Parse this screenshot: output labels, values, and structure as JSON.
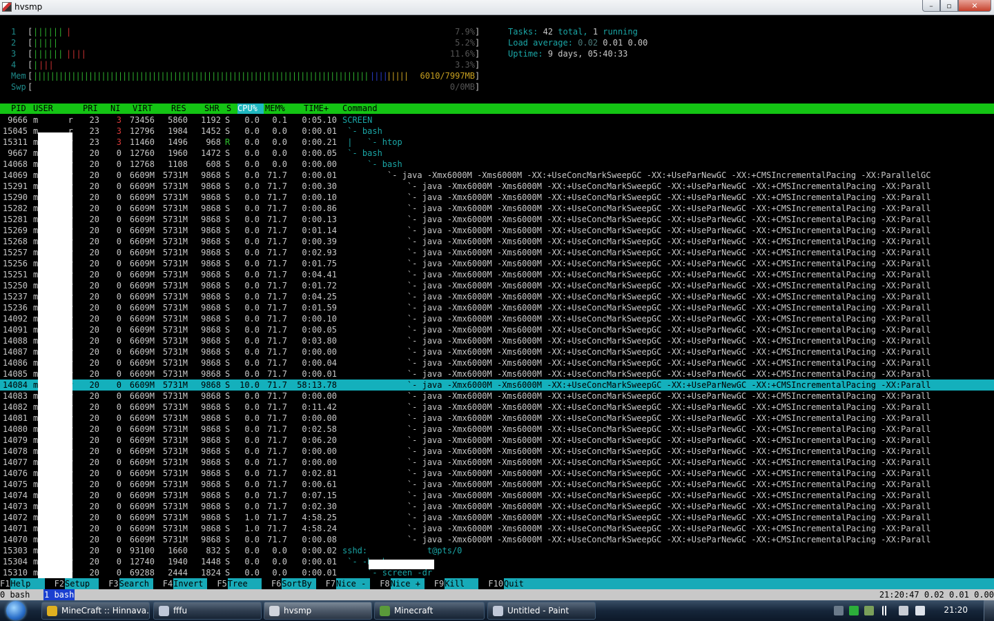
{
  "window": {
    "title": "hvsmp",
    "controls": {
      "minimize": "–",
      "maximize": "▫",
      "close": "✕"
    }
  },
  "meters": {
    "cpus": [
      {
        "label": "1",
        "bar": "||||||",
        "bar_hi": "|",
        "value": "7.9%"
      },
      {
        "label": "2",
        "bar": "|||||",
        "bar_hi": "",
        "value": "5.2%"
      },
      {
        "label": "3",
        "bar": "||||||",
        "bar_hi": "||||",
        "value": "11.6%"
      },
      {
        "label": "4",
        "bar": "|",
        "bar_hi": "|||",
        "value": "3.3%"
      }
    ],
    "mem": {
      "label": "Mem",
      "bar": "||||||||||||||||||||||||||||||||||||||||||||||||||||||||||||||||||||||||||||||||",
      "bar_blue": "||||",
      "bar_tail": "|||||",
      "value": "6010/7997MB"
    },
    "swp": {
      "label": "Swp",
      "value": "0/0MB"
    }
  },
  "info": {
    "tasks": {
      "label": "Tasks: ",
      "total": "42",
      "total_word": " total, ",
      "running": "1",
      "running_word": " running"
    },
    "load": {
      "label": "Load average: ",
      "l1": "0.02",
      "l5": "0.01",
      "l15": "0.00"
    },
    "uptime": {
      "label": "Uptime: ",
      "value": "9 days, 05:40:33"
    }
  },
  "columns": {
    "pid": "PID",
    "user": "USER",
    "pri": "PRI",
    "ni": "NI",
    "virt": "VIRT",
    "res": "RES",
    "shr": "SHR",
    "s": "S",
    "cpu": "CPU%",
    "mem": "MEM%",
    "time": "TIME+",
    "command": "Command"
  },
  "processes": [
    {
      "pid": "9666",
      "user": "m      r",
      "pri": "23",
      "ni": "3",
      "virt": "73456",
      "res": "5860",
      "shr": "1192",
      "s": "S",
      "cpu": "0.0",
      "mem": "0.1",
      "time": "0:05.10",
      "cmd": "SCREEN"
    },
    {
      "pid": "15045",
      "user": "m      r",
      "pri": "23",
      "ni": "3",
      "virt": "12796",
      "res": "1984",
      "shr": "1452",
      "s": "S",
      "cpu": "0.0",
      "mem": "0.0",
      "time": "0:00.01",
      "cmd": " `- bash"
    },
    {
      "pid": "15311",
      "user": "m      r",
      "pri": "23",
      "ni": "3",
      "virt": "11460",
      "res": "1496",
      "shr": "968",
      "s": "R",
      "cpu": "0.0",
      "mem": "0.0",
      "time": "0:00.21",
      "cmd": " |   `- htop"
    },
    {
      "pid": "9667",
      "user": "m      r",
      "pri": "20",
      "ni": "0",
      "virt": "12760",
      "res": "1960",
      "shr": "1472",
      "s": "S",
      "cpu": "0.0",
      "mem": "0.0",
      "time": "0:00.05",
      "cmd": " `- bash"
    },
    {
      "pid": "14068",
      "user": "m      r",
      "pri": "20",
      "ni": "0",
      "virt": "12768",
      "res": "1108",
      "shr": "608",
      "s": "S",
      "cpu": "0.0",
      "mem": "0.0",
      "time": "0:00.00",
      "cmd": "     `- bash"
    },
    {
      "pid": "14069",
      "user": "m      r",
      "pri": "20",
      "ni": "0",
      "virt": "6609M",
      "res": "5731M",
      "shr": "9868",
      "s": "S",
      "cpu": "0.0",
      "mem": "71.7",
      "time": "0:00.01",
      "cmd": "         `- java -Xmx6000M -Xms6000M -XX:+UseConcMarkSweepGC -XX:+UseParNewGC -XX:+CMSIncrementalPacing -XX:ParallelGC"
    },
    {
      "pid": "15291",
      "user": "m      r",
      "pri": "20",
      "ni": "0",
      "virt": "6609M",
      "res": "5731M",
      "shr": "9868",
      "s": "S",
      "cpu": "0.0",
      "mem": "71.7",
      "time": "0:00.30",
      "cmd": "             `- java -Xmx6000M -Xms6000M -XX:+UseConcMarkSweepGC -XX:+UseParNewGC -XX:+CMSIncrementalPacing -XX:Parall"
    },
    {
      "pid": "15290",
      "user": "m      r",
      "pri": "20",
      "ni": "0",
      "virt": "6609M",
      "res": "5731M",
      "shr": "9868",
      "s": "S",
      "cpu": "0.0",
      "mem": "71.7",
      "time": "0:00.10",
      "cmd": "             `- java -Xmx6000M -Xms6000M -XX:+UseConcMarkSweepGC -XX:+UseParNewGC -XX:+CMSIncrementalPacing -XX:Parall"
    },
    {
      "pid": "15282",
      "user": "m      r",
      "pri": "20",
      "ni": "0",
      "virt": "6609M",
      "res": "5731M",
      "shr": "9868",
      "s": "S",
      "cpu": "0.0",
      "mem": "71.7",
      "time": "0:00.86",
      "cmd": "             `- java -Xmx6000M -Xms6000M -XX:+UseConcMarkSweepGC -XX:+UseParNewGC -XX:+CMSIncrementalPacing -XX:Parall"
    },
    {
      "pid": "15281",
      "user": "m      r",
      "pri": "20",
      "ni": "0",
      "virt": "6609M",
      "res": "5731M",
      "shr": "9868",
      "s": "S",
      "cpu": "0.0",
      "mem": "71.7",
      "time": "0:00.13",
      "cmd": "             `- java -Xmx6000M -Xms6000M -XX:+UseConcMarkSweepGC -XX:+UseParNewGC -XX:+CMSIncrementalPacing -XX:Parall"
    },
    {
      "pid": "15269",
      "user": "m      r",
      "pri": "20",
      "ni": "0",
      "virt": "6609M",
      "res": "5731M",
      "shr": "9868",
      "s": "S",
      "cpu": "0.0",
      "mem": "71.7",
      "time": "0:01.14",
      "cmd": "             `- java -Xmx6000M -Xms6000M -XX:+UseConcMarkSweepGC -XX:+UseParNewGC -XX:+CMSIncrementalPacing -XX:Parall"
    },
    {
      "pid": "15268",
      "user": "m      r",
      "pri": "20",
      "ni": "0",
      "virt": "6609M",
      "res": "5731M",
      "shr": "9868",
      "s": "S",
      "cpu": "0.0",
      "mem": "71.7",
      "time": "0:00.39",
      "cmd": "             `- java -Xmx6000M -Xms6000M -XX:+UseConcMarkSweepGC -XX:+UseParNewGC -XX:+CMSIncrementalPacing -XX:Parall"
    },
    {
      "pid": "15257",
      "user": "m      r",
      "pri": "20",
      "ni": "0",
      "virt": "6609M",
      "res": "5731M",
      "shr": "9868",
      "s": "S",
      "cpu": "0.0",
      "mem": "71.7",
      "time": "0:02.93",
      "cmd": "             `- java -Xmx6000M -Xms6000M -XX:+UseConcMarkSweepGC -XX:+UseParNewGC -XX:+CMSIncrementalPacing -XX:Parall"
    },
    {
      "pid": "15256",
      "user": "m      r",
      "pri": "20",
      "ni": "0",
      "virt": "6609M",
      "res": "5731M",
      "shr": "9868",
      "s": "S",
      "cpu": "0.0",
      "mem": "71.7",
      "time": "0:01.75",
      "cmd": "             `- java -Xmx6000M -Xms6000M -XX:+UseConcMarkSweepGC -XX:+UseParNewGC -XX:+CMSIncrementalPacing -XX:Parall"
    },
    {
      "pid": "15251",
      "user": "m      r",
      "pri": "20",
      "ni": "0",
      "virt": "6609M",
      "res": "5731M",
      "shr": "9868",
      "s": "S",
      "cpu": "0.0",
      "mem": "71.7",
      "time": "0:04.41",
      "cmd": "             `- java -Xmx6000M -Xms6000M -XX:+UseConcMarkSweepGC -XX:+UseParNewGC -XX:+CMSIncrementalPacing -XX:Parall"
    },
    {
      "pid": "15250",
      "user": "m      r",
      "pri": "20",
      "ni": "0",
      "virt": "6609M",
      "res": "5731M",
      "shr": "9868",
      "s": "S",
      "cpu": "0.0",
      "mem": "71.7",
      "time": "0:01.72",
      "cmd": "             `- java -Xmx6000M -Xms6000M -XX:+UseConcMarkSweepGC -XX:+UseParNewGC -XX:+CMSIncrementalPacing -XX:Parall"
    },
    {
      "pid": "15237",
      "user": "m      r",
      "pri": "20",
      "ni": "0",
      "virt": "6609M",
      "res": "5731M",
      "shr": "9868",
      "s": "S",
      "cpu": "0.0",
      "mem": "71.7",
      "time": "0:04.25",
      "cmd": "             `- java -Xmx6000M -Xms6000M -XX:+UseConcMarkSweepGC -XX:+UseParNewGC -XX:+CMSIncrementalPacing -XX:Parall"
    },
    {
      "pid": "15236",
      "user": "m      r",
      "pri": "20",
      "ni": "0",
      "virt": "6609M",
      "res": "5731M",
      "shr": "9868",
      "s": "S",
      "cpu": "0.0",
      "mem": "71.7",
      "time": "0:01.59",
      "cmd": "             `- java -Xmx6000M -Xms6000M -XX:+UseConcMarkSweepGC -XX:+UseParNewGC -XX:+CMSIncrementalPacing -XX:Parall"
    },
    {
      "pid": "14092",
      "user": "m      r",
      "pri": "20",
      "ni": "0",
      "virt": "6609M",
      "res": "5731M",
      "shr": "9868",
      "s": "S",
      "cpu": "0.0",
      "mem": "71.7",
      "time": "0:00.10",
      "cmd": "             `- java -Xmx6000M -Xms6000M -XX:+UseConcMarkSweepGC -XX:+UseParNewGC -XX:+CMSIncrementalPacing -XX:Parall"
    },
    {
      "pid": "14091",
      "user": "m      r",
      "pri": "20",
      "ni": "0",
      "virt": "6609M",
      "res": "5731M",
      "shr": "9868",
      "s": "S",
      "cpu": "0.0",
      "mem": "71.7",
      "time": "0:00.05",
      "cmd": "             `- java -Xmx6000M -Xms6000M -XX:+UseConcMarkSweepGC -XX:+UseParNewGC -XX:+CMSIncrementalPacing -XX:Parall"
    },
    {
      "pid": "14088",
      "user": "m      r",
      "pri": "20",
      "ni": "0",
      "virt": "6609M",
      "res": "5731M",
      "shr": "9868",
      "s": "S",
      "cpu": "0.0",
      "mem": "71.7",
      "time": "0:03.80",
      "cmd": "             `- java -Xmx6000M -Xms6000M -XX:+UseConcMarkSweepGC -XX:+UseParNewGC -XX:+CMSIncrementalPacing -XX:Parall"
    },
    {
      "pid": "14087",
      "user": "m      r",
      "pri": "20",
      "ni": "0",
      "virt": "6609M",
      "res": "5731M",
      "shr": "9868",
      "s": "S",
      "cpu": "0.0",
      "mem": "71.7",
      "time": "0:00.00",
      "cmd": "             `- java -Xmx6000M -Xms6000M -XX:+UseConcMarkSweepGC -XX:+UseParNewGC -XX:+CMSIncrementalPacing -XX:Parall"
    },
    {
      "pid": "14086",
      "user": "m      r",
      "pri": "20",
      "ni": "0",
      "virt": "6609M",
      "res": "5731M",
      "shr": "9868",
      "s": "S",
      "cpu": "0.0",
      "mem": "71.7",
      "time": "0:00.04",
      "cmd": "             `- java -Xmx6000M -Xms6000M -XX:+UseConcMarkSweepGC -XX:+UseParNewGC -XX:+CMSIncrementalPacing -XX:Parall"
    },
    {
      "pid": "14085",
      "user": "m      r",
      "pri": "20",
      "ni": "0",
      "virt": "6609M",
      "res": "5731M",
      "shr": "9868",
      "s": "S",
      "cpu": "0.0",
      "mem": "71.7",
      "time": "0:00.01",
      "cmd": "             `- java -Xmx6000M -Xms6000M -XX:+UseConcMarkSweepGC -XX:+UseParNewGC -XX:+CMSIncrementalPacing -XX:Parall"
    },
    {
      "pid": "14084",
      "user": "m      r",
      "pri": "20",
      "ni": "0",
      "virt": "6609M",
      "res": "5731M",
      "shr": "9868",
      "s": "S",
      "cpu": "10.0",
      "mem": "71.7",
      "time": "58:13.78",
      "cmd": "             `- java -Xmx6000M -Xms6000M -XX:+UseConcMarkSweepGC -XX:+UseParNewGC -XX:+CMSIncrementalPacing -XX:Parall",
      "highlight": true
    },
    {
      "pid": "14083",
      "user": "m      r",
      "pri": "20",
      "ni": "0",
      "virt": "6609M",
      "res": "5731M",
      "shr": "9868",
      "s": "S",
      "cpu": "0.0",
      "mem": "71.7",
      "time": "0:00.00",
      "cmd": "             `- java -Xmx6000M -Xms6000M -XX:+UseConcMarkSweepGC -XX:+UseParNewGC -XX:+CMSIncrementalPacing -XX:Parall"
    },
    {
      "pid": "14082",
      "user": "m      r",
      "pri": "20",
      "ni": "0",
      "virt": "6609M",
      "res": "5731M",
      "shr": "9868",
      "s": "S",
      "cpu": "0.0",
      "mem": "71.7",
      "time": "0:11.42",
      "cmd": "             `- java -Xmx6000M -Xms6000M -XX:+UseConcMarkSweepGC -XX:+UseParNewGC -XX:+CMSIncrementalPacing -XX:Parall"
    },
    {
      "pid": "14081",
      "user": "m      r",
      "pri": "20",
      "ni": "0",
      "virt": "6609M",
      "res": "5731M",
      "shr": "9868",
      "s": "S",
      "cpu": "0.0",
      "mem": "71.7",
      "time": "0:00.00",
      "cmd": "             `- java -Xmx6000M -Xms6000M -XX:+UseConcMarkSweepGC -XX:+UseParNewGC -XX:+CMSIncrementalPacing -XX:Parall"
    },
    {
      "pid": "14080",
      "user": "m      r",
      "pri": "20",
      "ni": "0",
      "virt": "6609M",
      "res": "5731M",
      "shr": "9868",
      "s": "S",
      "cpu": "0.0",
      "mem": "71.7",
      "time": "0:02.58",
      "cmd": "             `- java -Xmx6000M -Xms6000M -XX:+UseConcMarkSweepGC -XX:+UseParNewGC -XX:+CMSIncrementalPacing -XX:Parall"
    },
    {
      "pid": "14079",
      "user": "m      r",
      "pri": "20",
      "ni": "0",
      "virt": "6609M",
      "res": "5731M",
      "shr": "9868",
      "s": "S",
      "cpu": "0.0",
      "mem": "71.7",
      "time": "0:06.20",
      "cmd": "             `- java -Xmx6000M -Xms6000M -XX:+UseConcMarkSweepGC -XX:+UseParNewGC -XX:+CMSIncrementalPacing -XX:Parall"
    },
    {
      "pid": "14078",
      "user": "m      r",
      "pri": "20",
      "ni": "0",
      "virt": "6609M",
      "res": "5731M",
      "shr": "9868",
      "s": "S",
      "cpu": "0.0",
      "mem": "71.7",
      "time": "0:00.00",
      "cmd": "             `- java -Xmx6000M -Xms6000M -XX:+UseConcMarkSweepGC -XX:+UseParNewGC -XX:+CMSIncrementalPacing -XX:Parall"
    },
    {
      "pid": "14077",
      "user": "m      r",
      "pri": "20",
      "ni": "0",
      "virt": "6609M",
      "res": "5731M",
      "shr": "9868",
      "s": "S",
      "cpu": "0.0",
      "mem": "71.7",
      "time": "0:00.00",
      "cmd": "             `- java -Xmx6000M -Xms6000M -XX:+UseConcMarkSweepGC -XX:+UseParNewGC -XX:+CMSIncrementalPacing -XX:Parall"
    },
    {
      "pid": "14076",
      "user": "m      r",
      "pri": "20",
      "ni": "0",
      "virt": "6609M",
      "res": "5731M",
      "shr": "9868",
      "s": "S",
      "cpu": "0.0",
      "mem": "71.7",
      "time": "0:02.81",
      "cmd": "             `- java -Xmx6000M -Xms6000M -XX:+UseConcMarkSweepGC -XX:+UseParNewGC -XX:+CMSIncrementalPacing -XX:Parall"
    },
    {
      "pid": "14075",
      "user": "m      r",
      "pri": "20",
      "ni": "0",
      "virt": "6609M",
      "res": "5731M",
      "shr": "9868",
      "s": "S",
      "cpu": "0.0",
      "mem": "71.7",
      "time": "0:00.61",
      "cmd": "             `- java -Xmx6000M -Xms6000M -XX:+UseConcMarkSweepGC -XX:+UseParNewGC -XX:+CMSIncrementalPacing -XX:Parall"
    },
    {
      "pid": "14074",
      "user": "m      r",
      "pri": "20",
      "ni": "0",
      "virt": "6609M",
      "res": "5731M",
      "shr": "9868",
      "s": "S",
      "cpu": "0.0",
      "mem": "71.7",
      "time": "0:07.15",
      "cmd": "             `- java -Xmx6000M -Xms6000M -XX:+UseConcMarkSweepGC -XX:+UseParNewGC -XX:+CMSIncrementalPacing -XX:Parall"
    },
    {
      "pid": "14073",
      "user": "m      r",
      "pri": "20",
      "ni": "0",
      "virt": "6609M",
      "res": "5731M",
      "shr": "9868",
      "s": "S",
      "cpu": "0.0",
      "mem": "71.7",
      "time": "0:02.30",
      "cmd": "             `- java -Xmx6000M -Xms6000M -XX:+UseConcMarkSweepGC -XX:+UseParNewGC -XX:+CMSIncrementalPacing -XX:Parall"
    },
    {
      "pid": "14072",
      "user": "m      r",
      "pri": "20",
      "ni": "0",
      "virt": "6609M",
      "res": "5731M",
      "shr": "9868",
      "s": "S",
      "cpu": "1.0",
      "mem": "71.7",
      "time": "4:58.25",
      "cmd": "             `- java -Xmx6000M -Xms6000M -XX:+UseConcMarkSweepGC -XX:+UseParNewGC -XX:+CMSIncrementalPacing -XX:Parall"
    },
    {
      "pid": "14071",
      "user": "m      r",
      "pri": "20",
      "ni": "0",
      "virt": "6609M",
      "res": "5731M",
      "shr": "9868",
      "s": "S",
      "cpu": "1.0",
      "mem": "71.7",
      "time": "4:58.24",
      "cmd": "             `- java -Xmx6000M -Xms6000M -XX:+UseConcMarkSweepGC -XX:+UseParNewGC -XX:+CMSIncrementalPacing -XX:Parall"
    },
    {
      "pid": "14070",
      "user": "m      r",
      "pri": "20",
      "ni": "0",
      "virt": "6609M",
      "res": "5731M",
      "shr": "9868",
      "s": "S",
      "cpu": "0.0",
      "mem": "71.7",
      "time": "0:00.08",
      "cmd": "             `- java -Xmx6000M -Xms6000M -XX:+UseConcMarkSweepGC -XX:+UseParNewGC -XX:+CMSIncrementalPacing -XX:Parall"
    },
    {
      "pid": "15303",
      "user": "m      r",
      "pri": "20",
      "ni": "0",
      "virt": "93100",
      "res": "1660",
      "shr": "832",
      "s": "S",
      "cpu": "0.0",
      "mem": "0.0",
      "time": "0:00.02",
      "cmd": "sshd:            t@pts/0"
    },
    {
      "pid": "15304",
      "user": "m      r",
      "pri": "20",
      "ni": "0",
      "virt": "12740",
      "res": "1940",
      "shr": "1448",
      "s": "S",
      "cpu": "0.0",
      "mem": "0.0",
      "time": "0:00.01",
      "cmd": " `- -bash"
    },
    {
      "pid": "15310",
      "user": "m      r",
      "pri": "20",
      "ni": "0",
      "virt": "69288",
      "res": "2444",
      "shr": "1824",
      "s": "S",
      "cpu": "0.0",
      "mem": "0.0",
      "time": "0:00.01",
      "cmd": "     `- screen -dr"
    }
  ],
  "fkeys": [
    {
      "key": "F1",
      "label": "Help  "
    },
    {
      "key": "F2",
      "label": "Setup "
    },
    {
      "key": "F3",
      "label": "Search"
    },
    {
      "key": "F4",
      "label": "Invert"
    },
    {
      "key": "F5",
      "label": "Tree  "
    },
    {
      "key": "F6",
      "label": "SortBy"
    },
    {
      "key": "F7",
      "label": "Nice -"
    },
    {
      "key": "F8",
      "label": "Nice +"
    },
    {
      "key": "F9",
      "label": "Kill  "
    },
    {
      "key": "F10",
      "label": "Quit"
    }
  ],
  "screen_bar": {
    "win0": "0 bash",
    "win1": "1 bash",
    "status": "21:20:47 0.02 0.01 0.00"
  },
  "taskbar": {
    "items": [
      {
        "label": "MineCraft :: Hinnava...",
        "icon": "chrome-icon",
        "color": "#e0b020"
      },
      {
        "label": "fffu",
        "icon": "paint-icon",
        "color": "#c0c8d8"
      },
      {
        "label": "hvsmp",
        "icon": "putty-icon",
        "color": "#d0d4dc",
        "active": true
      },
      {
        "label": "Minecraft",
        "icon": "minecraft-icon",
        "color": "#5a9a3a"
      },
      {
        "label": "Untitled - Paint",
        "icon": "paint-icon",
        "color": "#c0c8d8"
      }
    ],
    "clock": "21:20"
  }
}
